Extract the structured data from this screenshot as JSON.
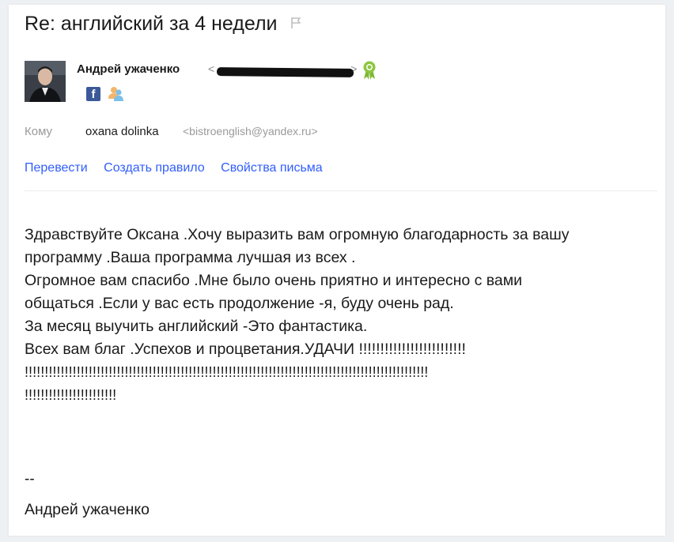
{
  "message": {
    "subject": "Re: английский за 4 недели",
    "sender": {
      "name": "Андрей ужаченко",
      "email_open": "<",
      "email_close": ">"
    },
    "to": {
      "label": "Кому",
      "name": "oxana dolinka",
      "email": "<bistroenglish@yandex.ru>"
    },
    "actions": {
      "translate": "Перевести",
      "create_rule": "Создать правило",
      "properties": "Свойства письма"
    },
    "body_lines": [
      "Здравствуйте Оксана .Хочу выразить  вам огромную благодарность за вашу",
      "программу .Ваша программа лучшая из всех .",
      "Огромное вам спасибо .Мне было очень приятно и интересно с вами",
      "общаться .Если у вас есть продолжение -я, буду очень рад.",
      "За месяц выучить английский -Это фантастика.",
      "Всех вам благ .Успехов и процветания.УДАЧИ !!!!!!!!!!!!!!!!!!!!!!!!!",
      "!!!!!!!!!!!!!!!!!!!!!!!!!!!!!!!!!!!!!!!!!!!!!!!!!!!!!!!!!!!!!!!!!!!!!!!!!!!!!!!!!!!!!!!!!!!!!!!!!!!!!",
      "!!!!!!!!!!!!!!!!!!!!!!!"
    ],
    "signature_separator": "--",
    "signature_name": "Андрей ужаченко"
  },
  "icons": {
    "flag": "flag-icon",
    "badge": "badge-icon",
    "facebook": "facebook-icon",
    "contact": "contact-icon"
  },
  "colors": {
    "link": "#315efb",
    "muted": "#9a9a9a",
    "facebook": "#3b5998",
    "badge": "#8cc63f"
  }
}
